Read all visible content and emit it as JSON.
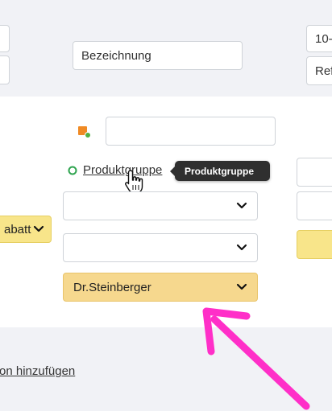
{
  "top": {
    "bezeichnung_placeholder": "Bezeichnung",
    "right_field_1": "10-",
    "right_field_2": "Ref"
  },
  "form": {
    "produktgruppe_link": "Produktgruppe",
    "tooltip_text": "Produktgruppe",
    "rabatt_select": "abatt",
    "dropdown_1_value": "",
    "dropdown_2_value": "",
    "doctor_select_value": "Dr.Steinberger"
  },
  "footer": {
    "add_link": "on hinzufügen"
  },
  "colors": {
    "tooltip_bg": "#2f2f2f",
    "highlight_select": "#f6d88e",
    "annotation_arrow": "#ff2fc8",
    "status_dot": "#2ea44f"
  }
}
